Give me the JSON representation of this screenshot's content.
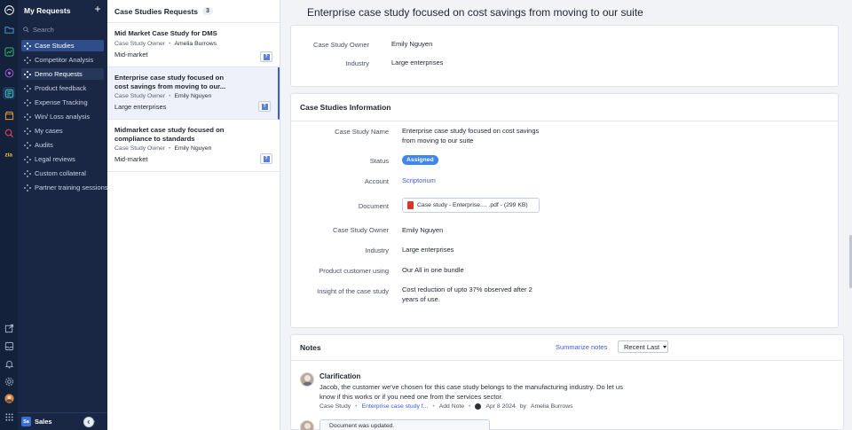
{
  "nav": {
    "title": "My Requests",
    "search_placeholder": "Search",
    "items": [
      {
        "label": "Case Studies"
      },
      {
        "label": "Competitor Analysis"
      },
      {
        "label": "Demo Requests"
      },
      {
        "label": "Product feedback"
      },
      {
        "label": "Expense Tracking"
      },
      {
        "label": "Win/ Loss analysis"
      },
      {
        "label": "My cases"
      },
      {
        "label": "Audits"
      },
      {
        "label": "Legal reviews"
      },
      {
        "label": "Custom collateral"
      },
      {
        "label": "Partner training sessions"
      }
    ],
    "workspace_badge": "Sa",
    "workspace_label": "Sales"
  },
  "list": {
    "title": "Case Studies Requests",
    "count": "3",
    "cards": [
      {
        "title": "Mid Market Case Study for DMS",
        "owner_label": "Case Study Owner",
        "owner": "Amelia Burrows",
        "industry": "Mid-market"
      },
      {
        "title": "Enterprise case study focused on cost savings from moving to our...",
        "owner_label": "Case Study Owner",
        "owner": "Emily Nguyen",
        "industry": "Large enterprises"
      },
      {
        "title": "Midmarket case study focused on compliance to standards",
        "owner_label": "Case Study Owner",
        "owner": "Emily Nguyen",
        "industry": "Mid-market"
      }
    ]
  },
  "detail": {
    "title": "Enterprise case study focused on cost savings from moving to our suite",
    "summary": {
      "owner_label": "Case Study Owner",
      "owner_value": "Emily Nguyen",
      "industry_label": "Industry",
      "industry_value": "Large enterprises"
    },
    "info": {
      "section_title": "Case Studies Information",
      "name_label": "Case Study Name",
      "name_value": "Enterprise case study focused on cost savings from moving to our suite",
      "status_label": "Status",
      "status_value": "Assigned",
      "account_label": "Account",
      "account_value": "Scriptorium",
      "document_label": "Document",
      "document_value": "Case study - Enterprise.... .pdf - (299 KB)",
      "owner_label": "Case Study Owner",
      "owner_value": "Emily Nguyen",
      "industry_label": "Industry",
      "industry_value": "Large enterprises",
      "product_label": "Product customer using",
      "product_value": "Our All in one bundle",
      "insight_label": "Insight of the case study",
      "insight_value": "Cost reduction of upto 37% observed after 2 years of use."
    },
    "notes": {
      "title": "Notes",
      "summarize_label": "Summarize notes",
      "sort_label": "Recent Last",
      "note1": {
        "title": "Clarification",
        "text": "Jacob, the customer we've chosen for this case study belongs to the manufacturing industry. Do let us know if this works or if you need one from the services sector.",
        "module": "Case Study",
        "record": "Enterprise case study f...",
        "add_note": "Add Note",
        "date": "Apr 8 2024",
        "by": "by",
        "author": "Amelia Burrows"
      },
      "note2_text": "Document was updated."
    }
  },
  "colors": {
    "rail": "#14213a",
    "sidebar": "#1a2744",
    "active_item": "#2e4d8a",
    "accent": "#3b5bdb",
    "status_badge": "#3f86e8"
  }
}
